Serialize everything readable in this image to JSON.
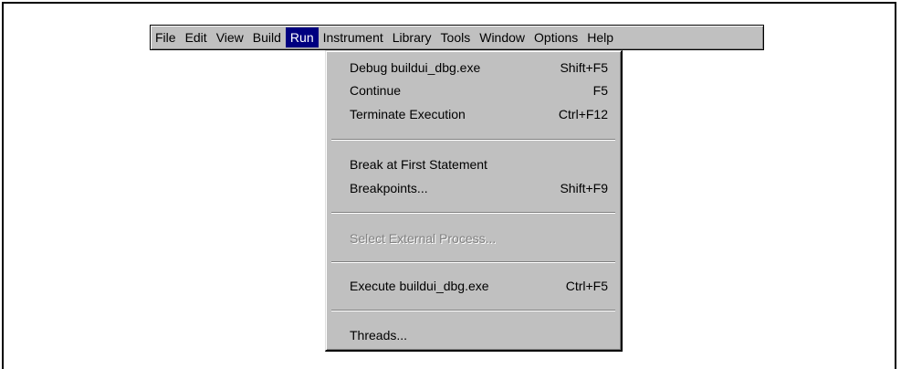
{
  "menubar": {
    "items": [
      {
        "label": "File"
      },
      {
        "label": "Edit"
      },
      {
        "label": "View"
      },
      {
        "label": "Build"
      },
      {
        "label": "Run"
      },
      {
        "label": "Instrument"
      },
      {
        "label": "Library"
      },
      {
        "label": "Tools"
      },
      {
        "label": "Window"
      },
      {
        "label": "Options"
      },
      {
        "label": "Help"
      }
    ]
  },
  "run_menu": {
    "items": [
      {
        "label": "Debug buildui_dbg.exe",
        "shortcut": "Shift+F5",
        "enabled": true
      },
      {
        "label": "Continue",
        "shortcut": "F5",
        "enabled": true
      },
      {
        "label": "Terminate Execution",
        "shortcut": "Ctrl+F12",
        "enabled": true
      },
      {
        "label": "Break at First Statement",
        "shortcut": "",
        "enabled": true
      },
      {
        "label": "Breakpoints...",
        "shortcut": "Shift+F9",
        "enabled": true
      },
      {
        "label": "Select External Process...",
        "shortcut": "",
        "enabled": false
      },
      {
        "label": "Execute buildui_dbg.exe",
        "shortcut": "Ctrl+F5",
        "enabled": true
      },
      {
        "label": "Threads...",
        "shortcut": "",
        "enabled": true
      }
    ]
  },
  "colors": {
    "menu_face": "#c0c0c0",
    "highlight": "#000080",
    "disabled_text": "#808080"
  }
}
